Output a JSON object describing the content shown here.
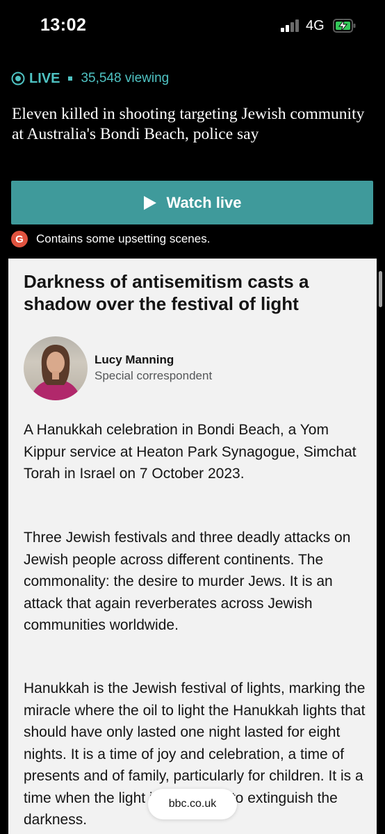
{
  "status_bar": {
    "time": "13:02",
    "network": "4G",
    "icons": [
      "cellular-signal-icon",
      "battery-charging-icon"
    ]
  },
  "live": {
    "label": "LIVE",
    "viewing": "35,548 viewing",
    "headline": "Eleven killed in shooting targeting Jewish community at Australia's Bondi Beach, police say",
    "watch_button": "Watch live",
    "guidance_badge": "G",
    "warning": "Contains some upsetting scenes.",
    "colors": {
      "accent": "#4fc3c3",
      "button": "#3f9a9b",
      "guidance": "#e0533f"
    }
  },
  "article": {
    "title": "Darkness of antisemitism casts a shadow over the festival of light",
    "author": {
      "name": "Lucy Manning",
      "role": "Special correspondent"
    },
    "paragraphs": [
      "A Hanukkah celebration in Bondi Beach, a Yom Kippur service at Heaton Park Synagogue, Simchat Torah in Israel on 7 October 2023.",
      "Three Jewish festivals and three deadly attacks on Jewish people across different continents. The commonality: the desire to murder Jews. It is an attack that again reverberates across Jewish communities worldwide.",
      "Hanukkah is the Jewish festival of lights, marking the miracle where the oil to light the Hanukkah lights that should have only lasted one night lasted for eight nights. It is a time of joy and celebration, a time of presents and of family, particularly for children. It is a time when the light is supposed to extinguish the darkness."
    ]
  },
  "browser": {
    "url": "bbc.co.uk"
  }
}
